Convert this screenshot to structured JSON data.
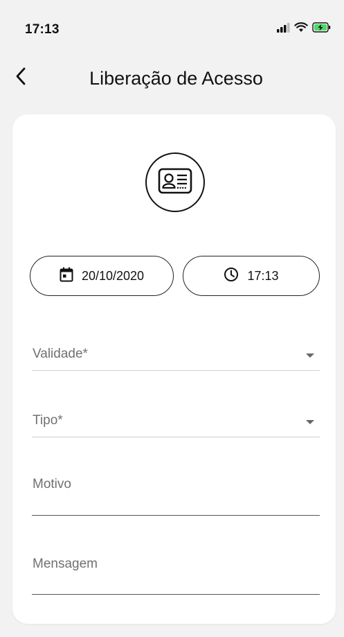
{
  "status_bar": {
    "time": "17:13"
  },
  "header": {
    "title": "Liberação de Acesso",
    "back_icon": "chevron-left-icon"
  },
  "card": {
    "icon": "id-card-icon",
    "date_button": {
      "icon": "calendar-icon",
      "label": "20/10/2020"
    },
    "time_button": {
      "icon": "clock-icon",
      "label": "17:13"
    },
    "fields": {
      "validade": {
        "label": "Validade*",
        "type": "select"
      },
      "tipo": {
        "label": "Tipo*",
        "type": "select"
      },
      "motivo": {
        "label": "Motivo",
        "type": "text"
      },
      "mensagem": {
        "label": "Mensagem",
        "type": "text"
      }
    }
  }
}
